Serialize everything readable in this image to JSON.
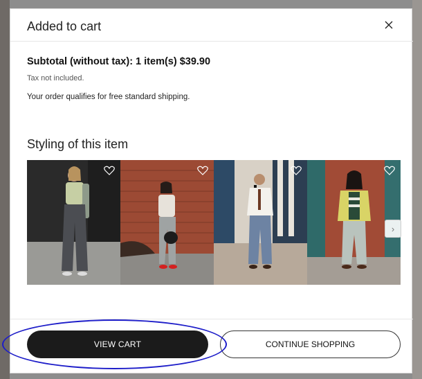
{
  "modal": {
    "title": "Added to cart",
    "subtotal": "Subtotal (without tax): 1 item(s) $39.90",
    "tax_note": "Tax not included.",
    "shipping_note": "Your order qualifies for free standard shipping.",
    "styling_title": "Styling of this item"
  },
  "carousel": {
    "items": [
      {
        "name": "outfit-1"
      },
      {
        "name": "outfit-2"
      },
      {
        "name": "outfit-3"
      },
      {
        "name": "outfit-4"
      }
    ],
    "next_arrow": "›"
  },
  "buttons": {
    "view_cart": "VIEW CART",
    "continue_shopping": "CONTINUE SHOPPING"
  },
  "icons": {
    "close": "close-icon",
    "heart": "heart-icon",
    "next": "chevron-right-icon"
  },
  "colors": {
    "primary_button": "#1b1b1b",
    "highlight": "#1d1dc9"
  }
}
